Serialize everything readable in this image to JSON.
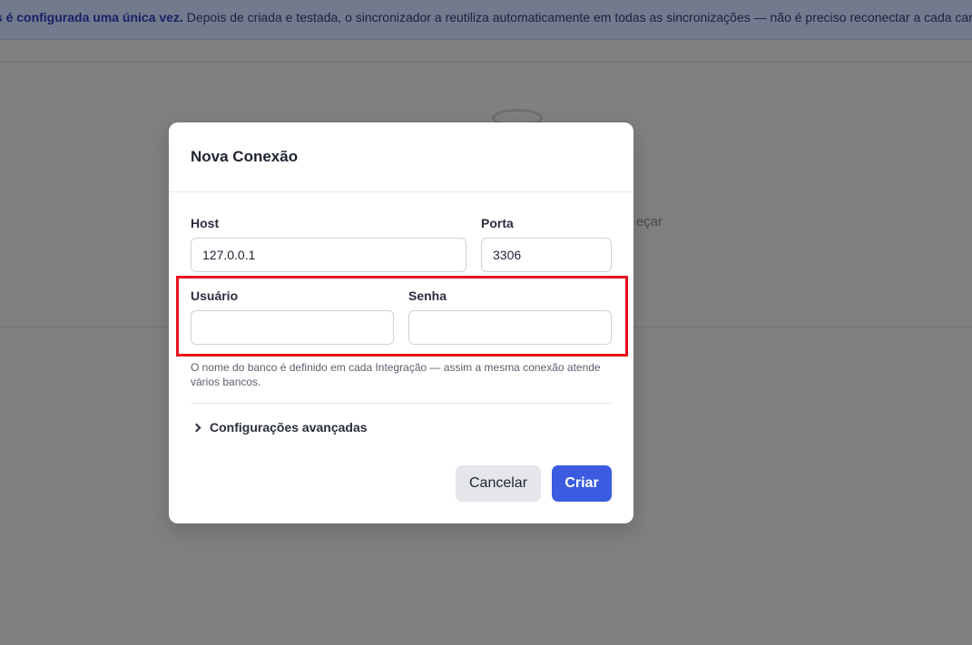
{
  "background": {
    "banner": {
      "bold_text": "ados é configurada uma única vez.",
      "text": " Depois de criada e testada, o sincronizador a reutiliza automaticamente em todas as sincronizações — não é preciso reconectar a cada car"
    },
    "empty_state_text": "eçar",
    "icon": "database-icon"
  },
  "modal": {
    "title": "Nova Conexão",
    "fields": {
      "host": {
        "label": "Host",
        "value": "127.0.0.1",
        "placeholder": ""
      },
      "port": {
        "label": "Porta",
        "value": "3306",
        "placeholder": ""
      },
      "user": {
        "label": "Usuário",
        "value": "",
        "placeholder": ""
      },
      "password": {
        "label": "Senha",
        "value": "",
        "placeholder": ""
      }
    },
    "help_text": "O nome do banco é definido em cada Integração — assim a mesma conexão atende vários bancos.",
    "advanced": {
      "label": "Configurações avançadas",
      "icon": "chevron-right-icon"
    },
    "buttons": {
      "cancel": "Cancelar",
      "create": "Criar"
    }
  },
  "colors": {
    "primary": "#3b5be0",
    "highlight": "#e8101a",
    "overlay": "#808080"
  }
}
